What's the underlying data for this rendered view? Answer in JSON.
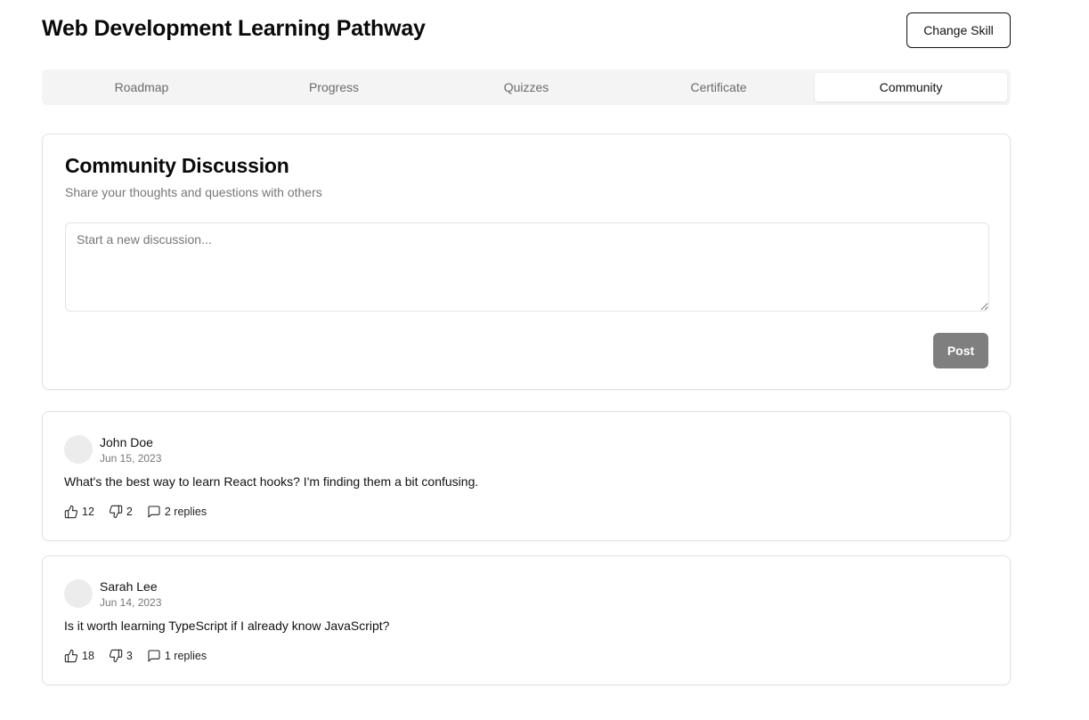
{
  "header": {
    "title": "Web Development Learning Pathway",
    "change_skill_label": "Change Skill"
  },
  "tabs": [
    {
      "label": "Roadmap",
      "active": false
    },
    {
      "label": "Progress",
      "active": false
    },
    {
      "label": "Quizzes",
      "active": false
    },
    {
      "label": "Certificate",
      "active": false
    },
    {
      "label": "Community",
      "active": true
    }
  ],
  "discussion": {
    "title": "Community Discussion",
    "subtitle": "Share your thoughts and questions with others",
    "input_placeholder": "Start a new discussion...",
    "input_value": "",
    "post_label": "Post"
  },
  "posts": [
    {
      "author": "John Doe",
      "date": "Jun 15, 2023",
      "body": "What's the best way to learn React hooks? I'm finding them a bit confusing.",
      "likes": "12",
      "dislikes": "2",
      "replies": "2 replies"
    },
    {
      "author": "Sarah Lee",
      "date": "Jun 14, 2023",
      "body": "Is it worth learning TypeScript if I already know JavaScript?",
      "likes": "18",
      "dislikes": "3",
      "replies": "1 replies"
    }
  ],
  "icons": {
    "like": "thumbs-up-icon",
    "dislike": "thumbs-down-icon",
    "replies": "message-square-icon"
  },
  "colors": {
    "post_button_bg": "#7f7f7f",
    "tab_bar_bg": "#f4f4f4",
    "border": "#e3e3e3"
  }
}
